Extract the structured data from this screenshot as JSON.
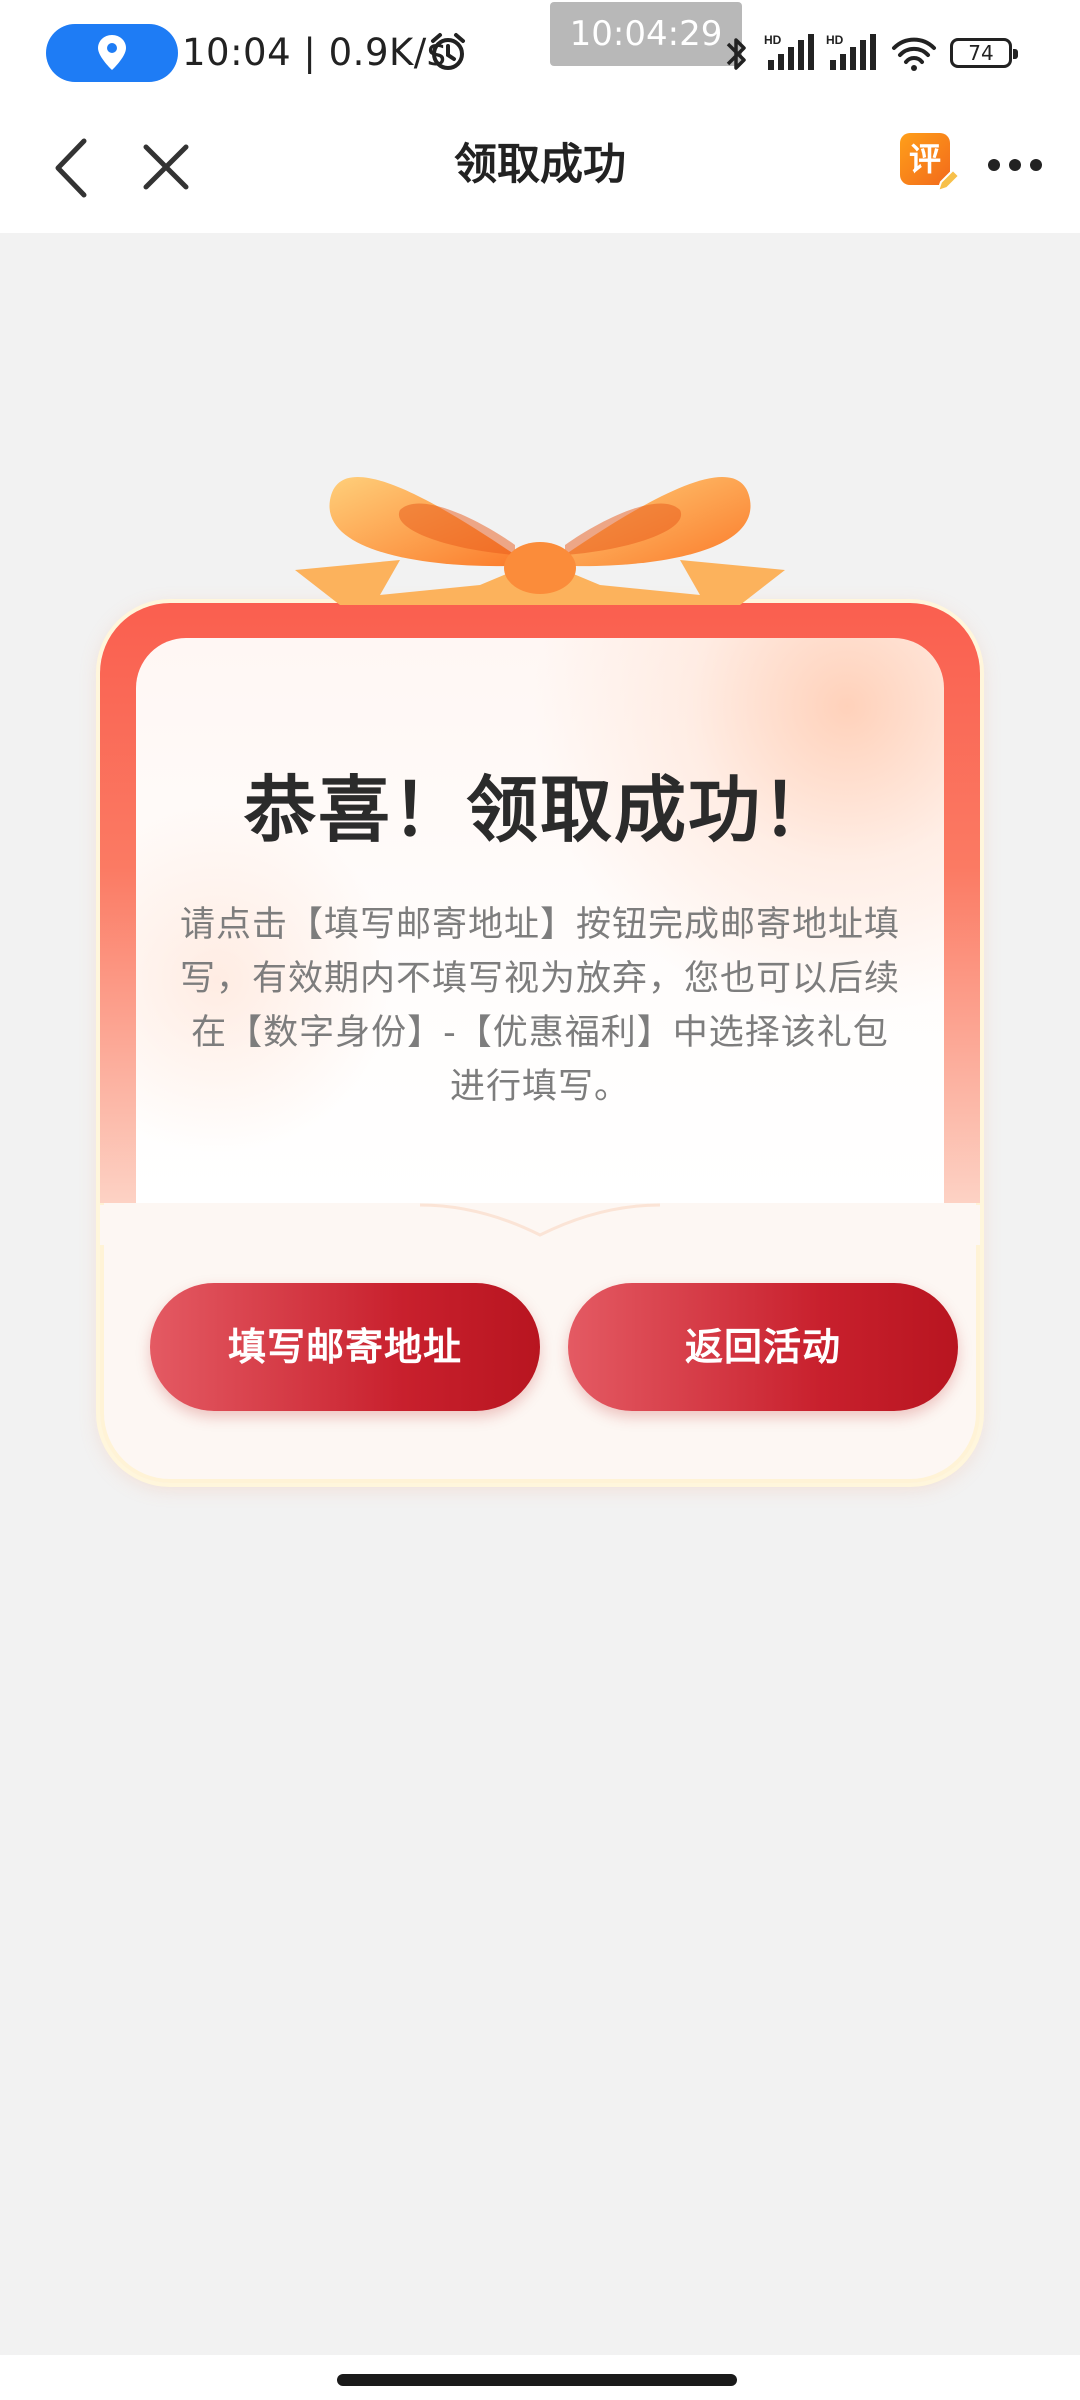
{
  "status_bar": {
    "time": "10:04",
    "speed": "0.9K/s",
    "time_badge": "10:04:29",
    "battery": "74",
    "signal1_label": "HD",
    "signal2_label": "HD"
  },
  "nav": {
    "title": "领取成功",
    "eval_label": "评"
  },
  "card": {
    "title": "恭喜！领取成功！",
    "description": "请点击【填写邮寄地址】按钮完成邮寄地址填写，有效期内不填写视为放弃，您也可以后续在【数字身份】-【优惠福利】中选择该礼包进行填写。"
  },
  "buttons": {
    "fill_address": "填写邮寄地址",
    "return_activity": "返回活动"
  },
  "colors": {
    "accent_blue": "#1e7cf5",
    "button_red": "#c8202d",
    "bow_orange": "#fb8c3a"
  }
}
